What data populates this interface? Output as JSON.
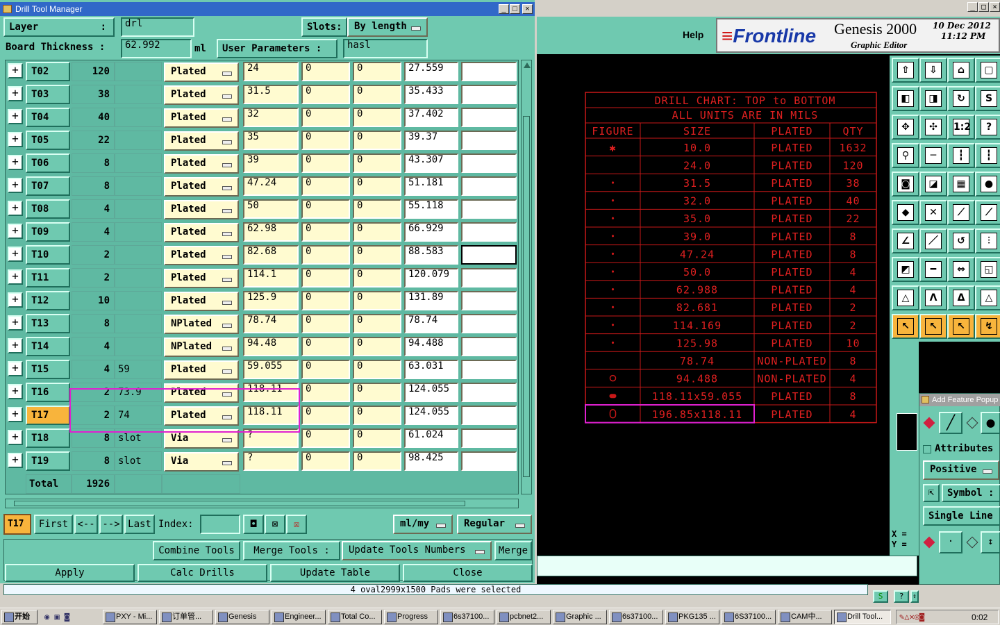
{
  "left_window": {
    "title": "Drill Tool Manager",
    "layer_label": "Layer",
    "layer_colon": ":",
    "layer_value": "drl",
    "slots_label": "Slots:",
    "slots_value": "By length",
    "board_thickness_label": "Board Thickness :",
    "board_thickness_value": "62.992",
    "board_thickness_unit": "ml",
    "user_params_label": "User Parameters :",
    "user_params_value": "hasl",
    "rows": [
      {
        "tool": "T02",
        "count": "120",
        "slot": "",
        "type": "Plated",
        "size": "24",
        "p1": "0",
        "p2": "0",
        "fin": "27.559",
        "extra": ""
      },
      {
        "tool": "T03",
        "count": "38",
        "slot": "",
        "type": "Plated",
        "size": "31.5",
        "p1": "0",
        "p2": "0",
        "fin": "35.433",
        "extra": ""
      },
      {
        "tool": "T04",
        "count": "40",
        "slot": "",
        "type": "Plated",
        "size": "32",
        "p1": "0",
        "p2": "0",
        "fin": "37.402",
        "extra": ""
      },
      {
        "tool": "T05",
        "count": "22",
        "slot": "",
        "type": "Plated",
        "size": "35",
        "p1": "0",
        "p2": "0",
        "fin": "39.37",
        "extra": ""
      },
      {
        "tool": "T06",
        "count": "8",
        "slot": "",
        "type": "Plated",
        "size": "39",
        "p1": "0",
        "p2": "0",
        "fin": "43.307",
        "extra": ""
      },
      {
        "tool": "T07",
        "count": "8",
        "slot": "",
        "type": "Plated",
        "size": "47.24",
        "p1": "0",
        "p2": "0",
        "fin": "51.181",
        "extra": ""
      },
      {
        "tool": "T08",
        "count": "4",
        "slot": "",
        "type": "Plated",
        "size": "50",
        "p1": "0",
        "p2": "0",
        "fin": "55.118",
        "extra": ""
      },
      {
        "tool": "T09",
        "count": "4",
        "slot": "",
        "type": "Plated",
        "size": "62.98",
        "p1": "0",
        "p2": "0",
        "fin": "66.929",
        "extra": ""
      },
      {
        "tool": "T10",
        "count": "2",
        "slot": "",
        "type": "Plated",
        "size": "82.68",
        "p1": "0",
        "p2": "0",
        "fin": "88.583",
        "extra": ""
      },
      {
        "tool": "T11",
        "count": "2",
        "slot": "",
        "type": "Plated",
        "size": "114.1",
        "p1": "0",
        "p2": "0",
        "fin": "120.079",
        "extra": ""
      },
      {
        "tool": "T12",
        "count": "10",
        "slot": "",
        "type": "Plated",
        "size": "125.9",
        "p1": "0",
        "p2": "0",
        "fin": "131.89",
        "extra": ""
      },
      {
        "tool": "T13",
        "count": "8",
        "slot": "",
        "type": "NPlated",
        "size": "78.74",
        "p1": "0",
        "p2": "0",
        "fin": "78.74",
        "extra": ""
      },
      {
        "tool": "T14",
        "count": "4",
        "slot": "",
        "type": "NPlated",
        "size": "94.48",
        "p1": "0",
        "p2": "0",
        "fin": "94.488",
        "extra": ""
      },
      {
        "tool": "T15",
        "count": "4",
        "slot": "59",
        "type": "Plated",
        "size": "59.055",
        "p1": "0",
        "p2": "0",
        "fin": "63.031",
        "extra": ""
      },
      {
        "tool": "T16",
        "count": "2",
        "slot": "73.9",
        "type": "Plated",
        "size": "118.11",
        "p1": "0",
        "p2": "0",
        "fin": "124.055",
        "extra": ""
      },
      {
        "tool": "T17",
        "count": "2",
        "slot": "74",
        "type": "Plated",
        "size": "118.11",
        "p1": "0",
        "p2": "0",
        "fin": "124.055",
        "extra": ""
      },
      {
        "tool": "T18",
        "count": "8",
        "slot": "slot",
        "type": "Via",
        "size": "?",
        "p1": "0",
        "p2": "0",
        "fin": "61.024",
        "extra": ""
      },
      {
        "tool": "T19",
        "count": "8",
        "slot": "slot",
        "type": "Via",
        "size": "?",
        "p1": "0",
        "p2": "0",
        "fin": "98.425",
        "extra": ""
      }
    ],
    "total_label": "Total",
    "total_value": "1926",
    "nav": {
      "current": "T17",
      "first": "First",
      "prev": "<--",
      "next": "-->",
      "last": "Last",
      "index_label": "Index:",
      "units": "ml/my",
      "mode": "Regular"
    },
    "buttons": {
      "combine": "Combine Tools",
      "merge_tools": "Merge Tools :",
      "update_numbers": "Update Tools Numbers",
      "merge": "Merge",
      "apply": "Apply",
      "calc": "Calc Drills",
      "update_table": "Update Table",
      "close": "Close"
    }
  },
  "right_window": {
    "help": "Help",
    "brand": "Frontline",
    "product": "Genesis 2000",
    "subtitle": "Graphic Editor",
    "date": "10 Dec 2012",
    "time": "11:12 PM",
    "chart_title1": "DRILL CHART: TOP to BOTTOM",
    "chart_title2": "ALL UNITS ARE IN MILS",
    "headers": [
      "FIGURE",
      "SIZE",
      "PLATED",
      "QTY"
    ],
    "chart_rows": [
      {
        "size": "10.0",
        "plated": "PLATED",
        "qty": "1632"
      },
      {
        "size": "24.0",
        "plated": "PLATED",
        "qty": "120"
      },
      {
        "size": "31.5",
        "plated": "PLATED",
        "qty": "38"
      },
      {
        "size": "32.0",
        "plated": "PLATED",
        "qty": "40"
      },
      {
        "size": "35.0",
        "plated": "PLATED",
        "qty": "22"
      },
      {
        "size": "39.0",
        "plated": "PLATED",
        "qty": "8"
      },
      {
        "size": "47.24",
        "plated": "PLATED",
        "qty": "8"
      },
      {
        "size": "50.0",
        "plated": "PLATED",
        "qty": "4"
      },
      {
        "size": "62.988",
        "plated": "PLATED",
        "qty": "4"
      },
      {
        "size": "82.681",
        "plated": "PLATED",
        "qty": "2"
      },
      {
        "size": "114.169",
        "plated": "PLATED",
        "qty": "2"
      },
      {
        "size": "125.98",
        "plated": "PLATED",
        "qty": "10"
      },
      {
        "size": "78.74",
        "plated": "NON-PLATED",
        "qty": "8"
      },
      {
        "size": "94.488",
        "plated": "NON-PLATED",
        "qty": "4"
      },
      {
        "size": "118.11x59.055",
        "plated": "PLATED",
        "qty": "8"
      },
      {
        "size": "196.85x118.11",
        "plated": "PLATED",
        "qty": "4"
      }
    ],
    "add_feature": {
      "title": "Add Feature Popup",
      "attributes": "Attributes",
      "polarity": "Positive",
      "symbol": "Symbol :",
      "line_mode": "Single Line"
    },
    "coord_x": "X =",
    "coord_y": "Y =",
    "status": "4 oval2999x1500 Pads were selected"
  },
  "taskbar": {
    "start": "开始",
    "clock": "0:02",
    "items": [
      "PXY - Mi...",
      "订单管...",
      "Genesis",
      "Engineer...",
      "Total Co...",
      "Progress",
      "6s37100...",
      "pcbnet2...",
      "Graphic ...",
      "6s37100...",
      "PKG135 ...",
      "6S37100...",
      "CAM中...",
      "Drill Tool..."
    ]
  }
}
